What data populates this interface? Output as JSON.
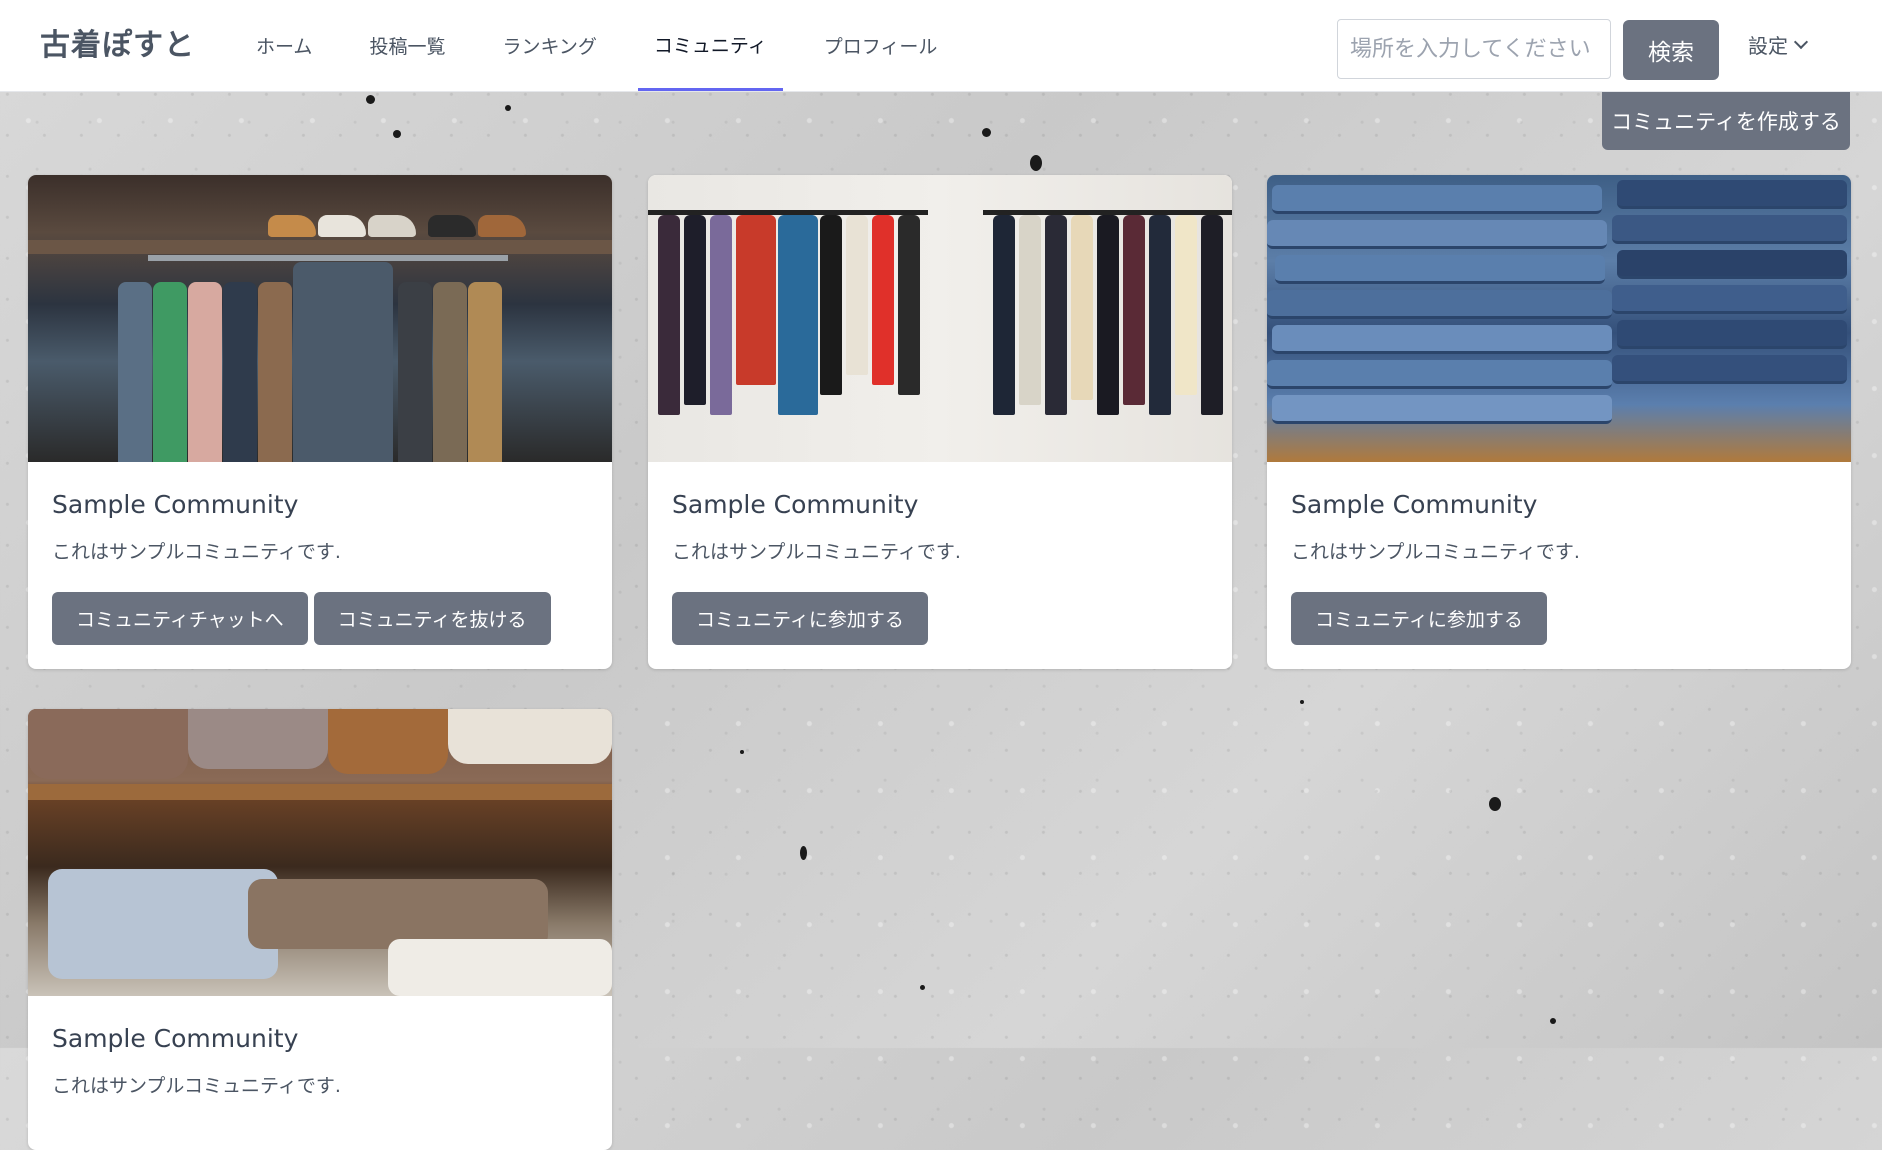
{
  "header": {
    "logo": "古着ぽすと",
    "nav": [
      {
        "label": "ホーム",
        "active": false
      },
      {
        "label": "投稿一覧",
        "active": false
      },
      {
        "label": "ランキング",
        "active": false
      },
      {
        "label": "コミュニティ",
        "active": true
      },
      {
        "label": "プロフィール",
        "active": false
      }
    ],
    "search": {
      "placeholder": "場所を入力してください",
      "button_label": "検索"
    },
    "settings_label": "設定"
  },
  "create_community_label": "コミュニティを作成する",
  "cards": [
    {
      "title": "Sample Community",
      "description": "これはサンプルコミュニティです.",
      "buttons": [
        "コミュニティチャットへ",
        "コミュニティを抜ける"
      ]
    },
    {
      "title": "Sample Community",
      "description": "これはサンプルコミュニティです.",
      "buttons": [
        "コミュニティに参加する"
      ]
    },
    {
      "title": "Sample Community",
      "description": "これはサンプルコミュニティです.",
      "buttons": [
        "コミュニティに参加する"
      ]
    },
    {
      "title": "Sample Community",
      "description": "これはサンプルコミュニティです.",
      "buttons": []
    }
  ],
  "colors": {
    "accent": "#6366f1",
    "button": "#6b7280"
  }
}
